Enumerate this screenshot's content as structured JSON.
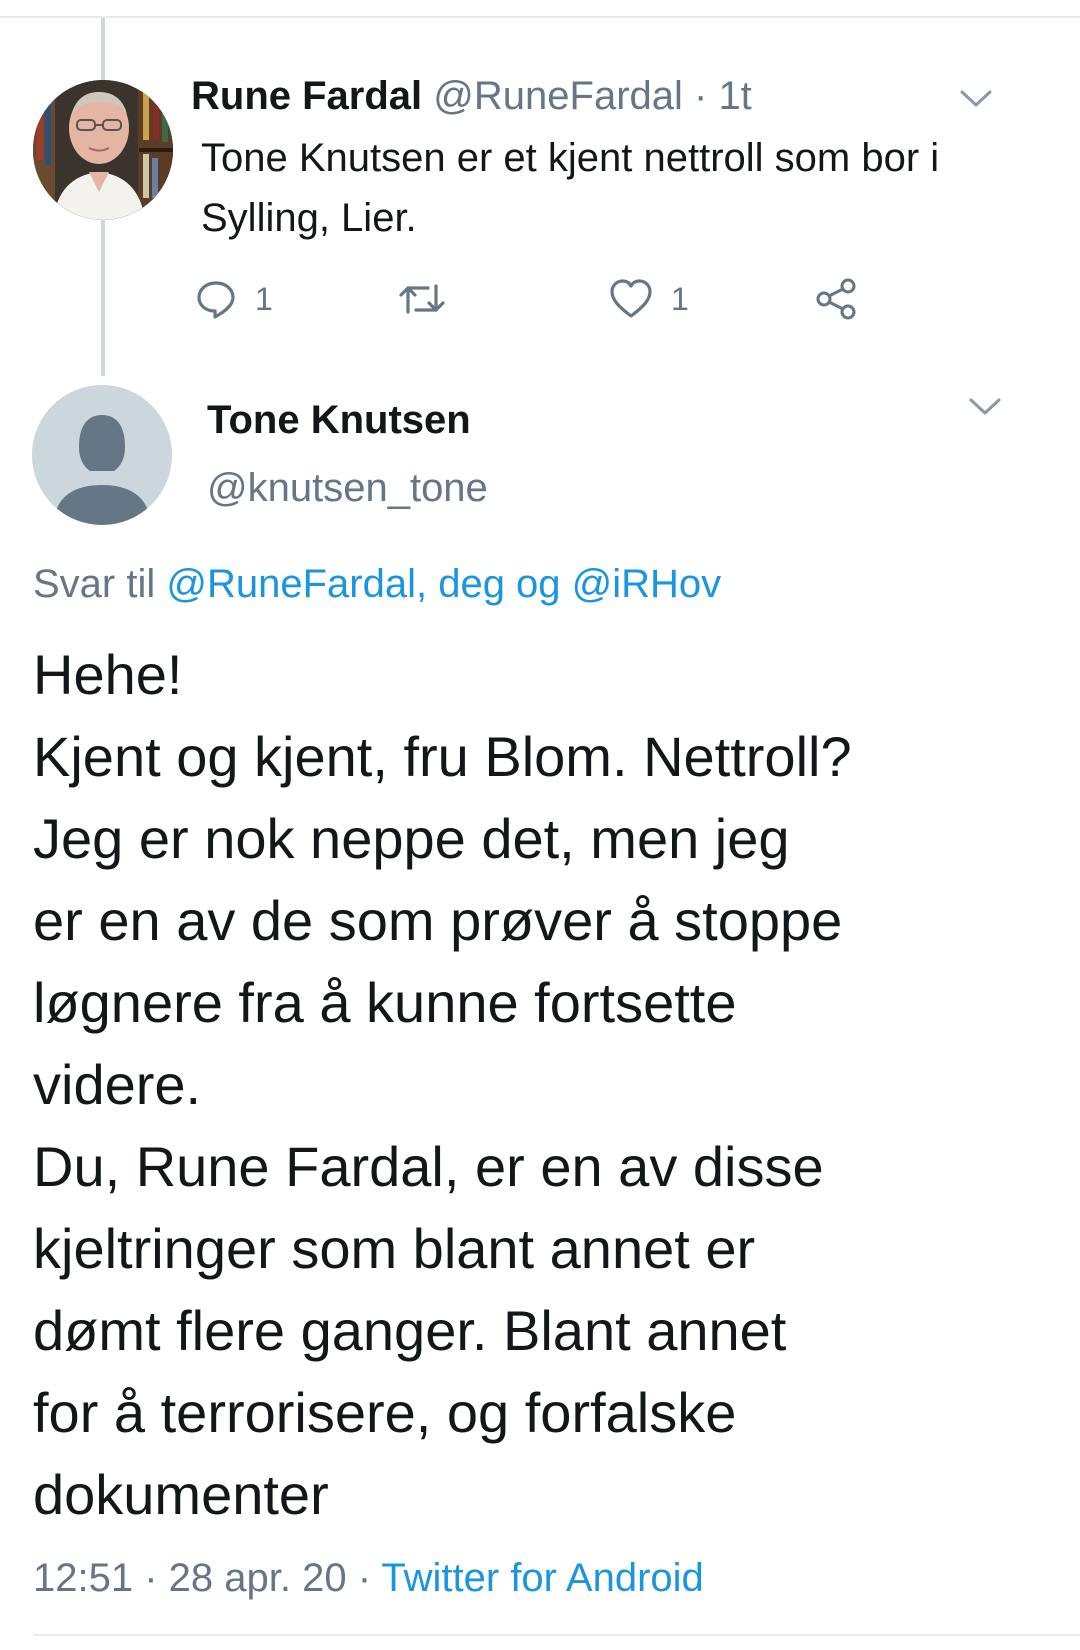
{
  "tweet1": {
    "display_name": "Rune Fardal",
    "handle": "@RuneFardal",
    "separator": " · ",
    "time": "1t",
    "text_line1": "Tone Knutsen er et kjent nettroll som bor i",
    "text_line2": "Sylling, Lier.",
    "reply_count": "1",
    "like_count": "1"
  },
  "tweet2": {
    "display_name": "Tone Knutsen",
    "handle": "@knutsen_tone",
    "reply_prefix": "Svar til ",
    "reply_targets": "@RuneFardal, deg og @iRHov",
    "body_lines": [
      "Hehe!",
      "Kjent og kjent, fru Blom. Nettroll?",
      "Jeg er nok neppe det, men jeg",
      "er en av de som prøver å stoppe",
      "løgnere fra å kunne fortsette",
      "videre.",
      "Du, Rune Fardal, er en av disse",
      "kjeltringer som blant annet er",
      "dømt flere ganger. Blant annet",
      "for å terrorisere, og forfalske",
      "dokumenter"
    ],
    "timestamp": "12:51 · 28 apr. 20 · ",
    "client": "Twitter for Android"
  },
  "colors": {
    "link": "#1b95e0",
    "muted": "#657786",
    "text": "#14171a",
    "divider": "#e6ecf0"
  },
  "icons": {
    "reply": "reply-icon",
    "retweet": "retweet-icon",
    "like": "heart-icon",
    "share": "share-icon",
    "chevron": "chevron-down-icon"
  }
}
